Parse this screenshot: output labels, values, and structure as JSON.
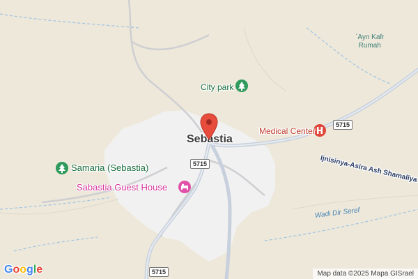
{
  "map": {
    "labels": {
      "town": "Sebastia",
      "city_park": "City park",
      "samaria": "Samaria (Sebastia)",
      "guest_house": "Sabastia Guest House",
      "medical_center": "Medical Center",
      "village": "`Ayn Kafr\nRumah",
      "wadi": "Wadi Dir Seref",
      "road": "Ijnisinya-Asira Ash Shamaliya"
    },
    "shields": {
      "center": "5715",
      "east": "5715",
      "south": "5715"
    },
    "attribution": "Map data ©2025 Mapa GISrael",
    "google_logo": [
      "G",
      "o",
      "o",
      "g",
      "l",
      "e"
    ],
    "icons": {
      "park": "tree-icon",
      "samaria_park": "tree-icon",
      "hotel": "bed-icon",
      "hospital": "hospital-icon",
      "pin": "location-pin-icon"
    },
    "colors": {
      "land": "#ede8da",
      "urban": "#f1f1f1",
      "road": "#b8c4d2",
      "water": "#9fc3e3",
      "pin": "#e74c3c"
    }
  }
}
